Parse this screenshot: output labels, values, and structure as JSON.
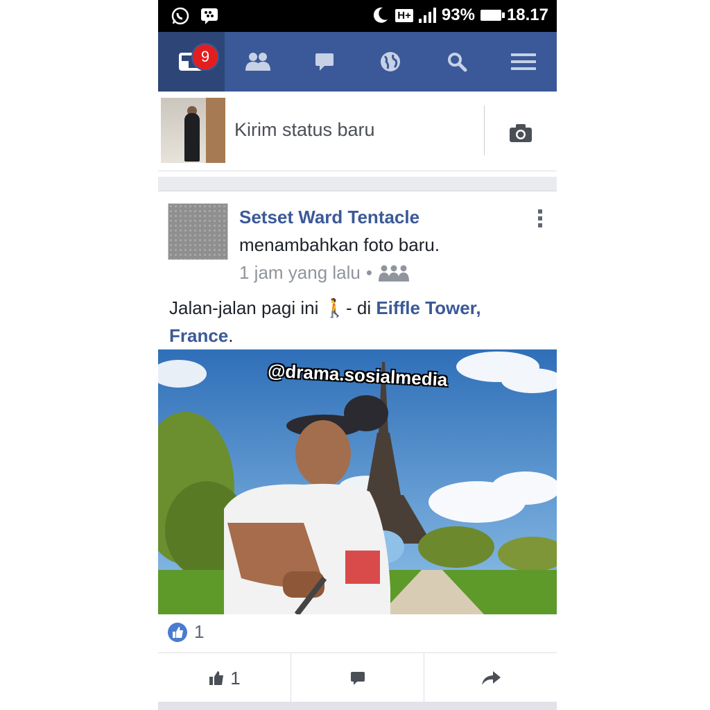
{
  "status_bar": {
    "network": "H+",
    "battery": "93%",
    "time": "18.17"
  },
  "nav": {
    "notification_count": "9",
    "items": [
      "news-feed",
      "friends",
      "messages",
      "notifications",
      "search",
      "menu"
    ]
  },
  "composer": {
    "placeholder": "Kirim status baru"
  },
  "post": {
    "author": "Setset Ward Tentacle",
    "action": "menambahkan foto baru.",
    "time": "1 jam yang lalu",
    "separator": "•",
    "text_before": "Jalan-jalan pagi ini",
    "emoji": "🚶",
    "text_mid": "- di",
    "location": "Eiffle Tower, France",
    "text_end": ".",
    "photo_watermark": "@drama.sosialmedia",
    "like_count": "1",
    "like_button_count": "1"
  },
  "colors": {
    "brand": "#3b5998",
    "nav_active": "#2d4677",
    "badge": "#e41e1e"
  }
}
